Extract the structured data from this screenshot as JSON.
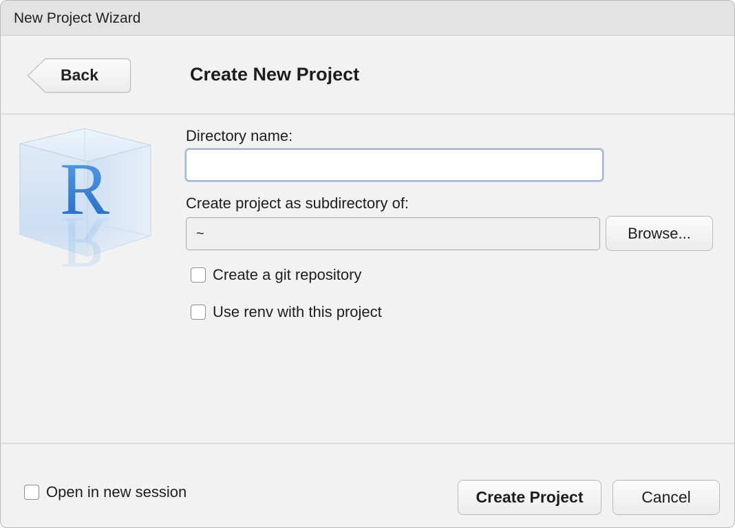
{
  "window": {
    "title": "New Project Wizard"
  },
  "header": {
    "back_label": "Back",
    "page_title": "Create New Project"
  },
  "logo": {
    "letter": "R",
    "icon": "r-project-cube-icon"
  },
  "form": {
    "directory_label": "Directory name:",
    "directory_value": "",
    "subdirectory_label": "Create project as subdirectory of:",
    "subdirectory_value": "~",
    "browse_label": "Browse...",
    "git_label": "Create a git repository",
    "git_checked": false,
    "renv_label": "Use renv with this project",
    "renv_checked": false
  },
  "footer": {
    "new_session_label": "Open in new session",
    "new_session_checked": false,
    "create_label": "Create Project",
    "cancel_label": "Cancel"
  },
  "colors": {
    "window_bg": "#f1f2f1",
    "titlebar_bg": "#e3e3e3",
    "focus_ring": "#9fb6d6",
    "logo_blue": "#2f7fd6"
  }
}
